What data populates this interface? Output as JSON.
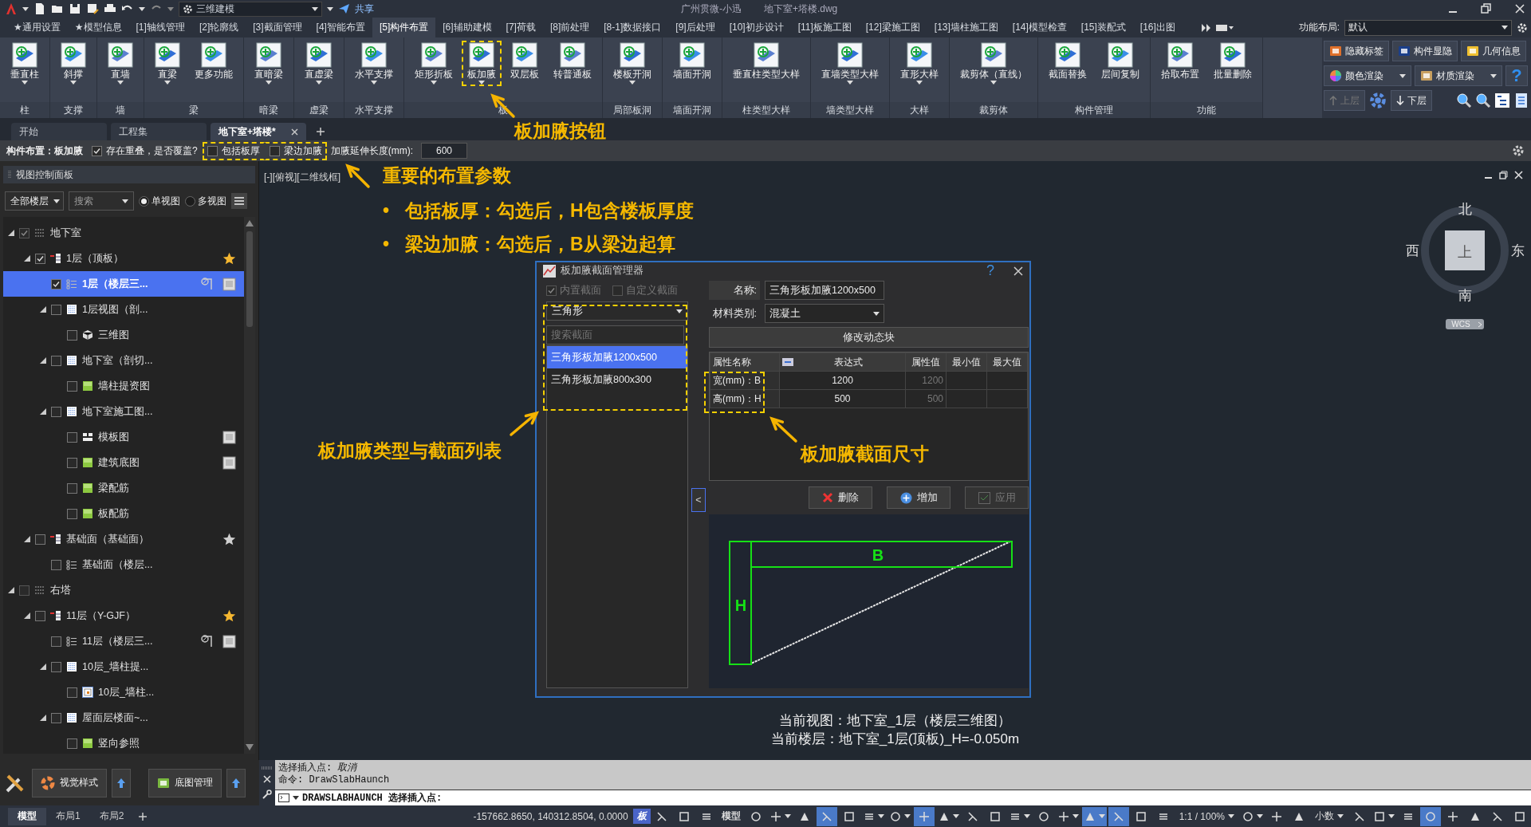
{
  "title_bar": {
    "workspace": "三维建模",
    "share": "共享",
    "app_name": "广州贯微-小迅",
    "file_name": "地下室+塔楼.dwg"
  },
  "ribbon_tabs": [
    {
      "label": "★通用设置",
      "selected": false
    },
    {
      "label": "★模型信息",
      "selected": false
    },
    {
      "label": "[1]轴线管理",
      "selected": false
    },
    {
      "label": "[2]轮廓线",
      "selected": false
    },
    {
      "label": "[3]截面管理",
      "selected": false
    },
    {
      "label": "[4]智能布置",
      "selected": false
    },
    {
      "label": "[5]构件布置",
      "selected": true
    },
    {
      "label": "[6]辅助建模",
      "selected": false
    },
    {
      "label": "[7]荷载",
      "selected": false
    },
    {
      "label": "[8]前处理",
      "selected": false
    },
    {
      "label": "[8-1]数据接口",
      "selected": false
    },
    {
      "label": "[9]后处理",
      "selected": false
    },
    {
      "label": "[10]初步设计",
      "selected": false
    },
    {
      "label": "[11]板施工图",
      "selected": false
    },
    {
      "label": "[12]梁施工图",
      "selected": false
    },
    {
      "label": "[13]墙柱施工图",
      "selected": false
    },
    {
      "label": "[14]模型检查",
      "selected": false
    },
    {
      "label": "[15]装配式",
      "selected": false
    },
    {
      "label": "[16]出图",
      "selected": false
    }
  ],
  "layout_selector": {
    "label": "功能布局:",
    "value": "默认"
  },
  "ribbon_groups": [
    {
      "title": "柱",
      "buttons": [
        {
          "label": "垂直柱",
          "dropdown": true,
          "highlighted": false
        }
      ]
    },
    {
      "title": "支撑",
      "buttons": [
        {
          "label": "斜撑",
          "dropdown": true,
          "highlighted": false
        }
      ]
    },
    {
      "title": "墙",
      "buttons": [
        {
          "label": "直墙",
          "dropdown": true,
          "highlighted": false
        }
      ]
    },
    {
      "title": "梁",
      "buttons": [
        {
          "label": "直梁",
          "dropdown": true,
          "highlighted": false
        },
        {
          "label": "更多功能",
          "dropdown": false,
          "highlighted": false
        }
      ]
    },
    {
      "title": "暗梁",
      "buttons": [
        {
          "label": "直暗梁",
          "dropdown": true,
          "highlighted": false
        }
      ]
    },
    {
      "title": "虚梁",
      "buttons": [
        {
          "label": "直虚梁",
          "dropdown": true,
          "highlighted": false
        }
      ]
    },
    {
      "title": "水平支撑",
      "buttons": [
        {
          "label": "水平支撑",
          "dropdown": true,
          "highlighted": false
        }
      ]
    },
    {
      "title": "板",
      "buttons": [
        {
          "label": "矩形折板",
          "dropdown": true,
          "highlighted": false
        },
        {
          "label": "板加腋",
          "dropdown": true,
          "highlighted": true
        },
        {
          "label": "双层板",
          "dropdown": false,
          "highlighted": false
        },
        {
          "label": "转普通板",
          "dropdown": false,
          "highlighted": false
        }
      ]
    },
    {
      "title": "局部板洞",
      "buttons": [
        {
          "label": "楼板开洞",
          "dropdown": true,
          "highlighted": false
        }
      ]
    },
    {
      "title": "墙面开洞",
      "buttons": [
        {
          "label": "墙面开洞",
          "dropdown": false,
          "highlighted": false
        }
      ]
    },
    {
      "title": "柱类型大样",
      "buttons": [
        {
          "label": "垂直柱类型大样",
          "dropdown": false,
          "highlighted": false
        }
      ]
    },
    {
      "title": "墙类型大样",
      "buttons": [
        {
          "label": "直墙类型大样",
          "dropdown": true,
          "highlighted": false
        }
      ]
    },
    {
      "title": "大样",
      "buttons": [
        {
          "label": "直形大样",
          "dropdown": true,
          "highlighted": false
        }
      ]
    },
    {
      "title": "裁剪体",
      "buttons": [
        {
          "label": "裁剪体（直线）",
          "dropdown": true,
          "highlighted": false
        }
      ]
    },
    {
      "title": "构件管理",
      "buttons": [
        {
          "label": "截面替换",
          "dropdown": false,
          "highlighted": false
        },
        {
          "label": "层间复制",
          "dropdown": false,
          "highlighted": false
        }
      ]
    },
    {
      "title": "功能",
      "buttons": [
        {
          "label": "拾取布置",
          "dropdown": false,
          "highlighted": false
        },
        {
          "label": "批量删除",
          "dropdown": false,
          "highlighted": false
        }
      ]
    }
  ],
  "ribbon_side": {
    "toggles": [
      "隐藏标签",
      "构件显隐",
      "几何信息"
    ],
    "renders": [
      "颜色渲染",
      "材质渲染"
    ],
    "help": "?",
    "floor_up": {
      "label": "上层",
      "disabled": true
    },
    "floor_down": {
      "label": "下层",
      "disabled": false
    }
  },
  "doc_tabs": [
    {
      "label": "开始",
      "selected": false,
      "closable": false
    },
    {
      "label": "工程集",
      "selected": false,
      "closable": false
    },
    {
      "label": "地下室+塔楼*",
      "selected": true,
      "closable": true
    }
  ],
  "options_bar": {
    "label": "构件布置：板加腋",
    "options": [
      {
        "label": "存在重叠，是否覆盖?",
        "checked": true,
        "highlighted": false
      },
      {
        "label": "包括板厚",
        "checked": false,
        "highlighted": true
      },
      {
        "label": "梁边加腋",
        "checked": false,
        "highlighted": true
      }
    ],
    "extend_label": "加腋延伸长度(mm):",
    "extend_value": "600"
  },
  "view_panel": {
    "title": "视图控制面板",
    "floor_filter": "全部楼层",
    "search_placeholder": "搜索",
    "view_modes": [
      {
        "label": "单视图",
        "selected": true
      },
      {
        "label": "多视图",
        "selected": false
      }
    ],
    "tree": [
      {
        "label": "地下室",
        "kind": "group",
        "checked": true,
        "selected": false,
        "expanded": true,
        "children": [
          {
            "label": "1层（顶板）",
            "kind": "floor",
            "checked": true,
            "selected": false,
            "expanded": true,
            "star": true,
            "children": [
              {
                "label": "1层（楼层三...",
                "kind": "list",
                "checked": true,
                "selected": true,
                "tools": [
                  {
                    "kind": "section"
                  },
                  {
                    "kind": "sheet"
                  }
                ]
              },
              {
                "label": "1层视图（剖...",
                "kind": "view",
                "checked": false,
                "selected": false,
                "expanded": true,
                "children": [
                  {
                    "label": "三维图",
                    "kind": "cube",
                    "checked": false,
                    "selected": false
                  }
                ]
              },
              {
                "label": "地下室（剖切...",
                "kind": "view",
                "checked": false,
                "selected": false,
                "expanded": true,
                "children": [
                  {
                    "label": "墙柱提资图",
                    "kind": "green",
                    "checked": false,
                    "selected": false
                  }
                ]
              },
              {
                "label": "地下室施工图...",
                "kind": "view",
                "checked": false,
                "selected": false,
                "expanded": true,
                "children": [
                  {
                    "label": "模板图",
                    "kind": "plan",
                    "checked": false,
                    "selected": false,
                    "tools": [
                      {
                        "kind": "sheet"
                      }
                    ]
                  },
                  {
                    "label": "建筑底图",
                    "kind": "green",
                    "checked": false,
                    "selected": false,
                    "tools": [
                      {
                        "kind": "sheet"
                      }
                    ]
                  },
                  {
                    "label": "梁配筋",
                    "kind": "green",
                    "checked": false,
                    "selected": false
                  },
                  {
                    "label": "板配筋",
                    "kind": "green",
                    "checked": false,
                    "selected": false
                  }
                ]
              }
            ]
          },
          {
            "label": "基础面（基础面）",
            "kind": "floor",
            "checked": false,
            "selected": false,
            "expanded": true,
            "star": false,
            "children": [
              {
                "label": "基础面（楼层...",
                "kind": "list",
                "checked": false,
                "selected": false
              }
            ]
          }
        ]
      },
      {
        "label": "右塔",
        "kind": "group",
        "checked": false,
        "selected": false,
        "expanded": true,
        "children": [
          {
            "label": "11层（Y-GJF）",
            "kind": "floor",
            "checked": false,
            "selected": false,
            "expanded": true,
            "star": true,
            "children": [
              {
                "label": "11层（楼层三...",
                "kind": "list",
                "checked": false,
                "selected": false,
                "tools": [
                  {
                    "kind": "section"
                  },
                  {
                    "kind": "sheet"
                  }
                ]
              },
              {
                "label": "10层_墙柱提...",
                "kind": "view",
                "checked": false,
                "selected": false,
                "expanded": true,
                "children": [
                  {
                    "label": "10层_墙柱...",
                    "kind": "frame",
                    "checked": false,
                    "selected": false
                  }
                ]
              },
              {
                "label": "屋面层楼面~...",
                "kind": "view",
                "checked": false,
                "selected": false,
                "expanded": true,
                "children": [
                  {
                    "label": "竖向参照",
                    "kind": "green",
                    "checked": false,
                    "selected": false
                  }
                ]
              }
            ]
          }
        ]
      }
    ],
    "bottom_buttons": [
      "视觉样式",
      "底图管理"
    ]
  },
  "viewport": {
    "label": "[-][俯视][二维线框]",
    "compass": {
      "north": "北",
      "south": "南",
      "east": "东",
      "west": "西",
      "top": "上",
      "wcs": "WCS"
    },
    "current_view": "当前视图：地下室_1层（楼层三维图）",
    "current_floor": "当前楼层：地下室_1层(顶板)_H=-0.050m"
  },
  "dialog": {
    "title": "板加腋截面管理器",
    "help": "?",
    "filters": [
      {
        "label": "内置截面",
        "checked": true,
        "disabled": true
      },
      {
        "label": "自定义截面",
        "checked": false,
        "disabled": true
      }
    ],
    "shape": "三角形",
    "search_placeholder": "搜索截面",
    "sections": [
      {
        "label": "三角形板加腋1200x500",
        "selected": true
      },
      {
        "label": "三角形板加腋800x300",
        "selected": false
      }
    ],
    "name_label": "名称:",
    "name_value": "三角形板加腋1200x500",
    "material_label": "材料类别:",
    "material_value": "混凝土",
    "modify_button": "修改动态块",
    "columns": [
      "属性名称",
      "表达式",
      "属性值",
      "最小值",
      "最大值"
    ],
    "rows": [
      {
        "name": "宽(mm)：B",
        "expression": "1200",
        "value": "1200"
      },
      {
        "name": "高(mm)：H",
        "expression": "500",
        "value": "500"
      }
    ],
    "collapse": "<",
    "buttons": [
      {
        "kind": "delete",
        "label": "删除",
        "disabled": false
      },
      {
        "kind": "add",
        "label": "增加",
        "disabled": false
      },
      {
        "kind": "apply",
        "label": "应用",
        "disabled": true
      }
    ],
    "preview_labels": {
      "width": "B",
      "height": "H"
    }
  },
  "command": {
    "history": [
      "选择插入点: *取消*",
      "命令: DrawSlabHaunch"
    ],
    "prompt": "DRAWSLABHAUNCH 选择插入点:"
  },
  "layout_tabs": [
    {
      "label": "模型",
      "selected": true
    },
    {
      "label": "布局1",
      "selected": false
    },
    {
      "label": "布局2",
      "selected": false
    }
  ],
  "status_bar": {
    "coordinates": "-157662.8650, 140312.8504, 0.0000",
    "items": [
      {
        "kind": "badge",
        "label": "板"
      },
      {
        "kind": "toggle",
        "on": false,
        "dropdown": false
      },
      {
        "kind": "toggle",
        "on": false,
        "dropdown": false
      },
      {
        "kind": "toggle",
        "on": false,
        "dropdown": false
      },
      {
        "kind": "text",
        "label": "模型"
      },
      {
        "kind": "toggle",
        "on": false,
        "dropdown": false
      },
      {
        "kind": "toggle",
        "on": false,
        "dropdown": true
      },
      {
        "kind": "toggle",
        "on": false,
        "dropdown": false
      },
      {
        "kind": "toggle",
        "on": true,
        "dropdown": false
      },
      {
        "kind": "toggle",
        "on": false,
        "dropdown": false
      },
      {
        "kind": "toggle",
        "on": false,
        "dropdown": true
      },
      {
        "kind": "toggle",
        "on": false,
        "dropdown": true
      },
      {
        "kind": "toggle",
        "on": true,
        "dropdown": false
      },
      {
        "kind": "toggle",
        "on": false,
        "dropdown": true
      },
      {
        "kind": "toggle",
        "on": false,
        "dropdown": false
      },
      {
        "kind": "toggle",
        "on": false,
        "dropdown": false
      },
      {
        "kind": "toggle",
        "on": false,
        "dropdown": true
      },
      {
        "kind": "toggle",
        "on": false,
        "dropdown": false
      },
      {
        "kind": "toggle",
        "on": false,
        "dropdown": true
      },
      {
        "kind": "toggle",
        "on": true,
        "dropdown": true
      },
      {
        "kind": "toggle",
        "on": true,
        "dropdown": false
      },
      {
        "kind": "toggle",
        "on": false,
        "dropdown": false
      },
      {
        "kind": "toggle",
        "on": false,
        "dropdown": false
      },
      {
        "kind": "dropdown",
        "label": "1:1 / 100%"
      },
      {
        "kind": "toggle",
        "on": false,
        "dropdown": true
      },
      {
        "kind": "toggle",
        "on": false,
        "dropdown": false
      },
      {
        "kind": "toggle",
        "on": false,
        "dropdown": false
      },
      {
        "kind": "dropdown",
        "label": "小数"
      },
      {
        "kind": "toggle",
        "on": false,
        "dropdown": false
      },
      {
        "kind": "toggle",
        "on": false,
        "dropdown": true
      },
      {
        "kind": "toggle",
        "on": false,
        "dropdown": false
      },
      {
        "kind": "toggle",
        "on": true,
        "dropdown": false
      },
      {
        "kind": "toggle",
        "on": false,
        "dropdown": false
      },
      {
        "kind": "toggle",
        "on": false,
        "dropdown": false
      },
      {
        "kind": "toggle",
        "on": false,
        "dropdown": false
      },
      {
        "kind": "toggle",
        "on": false,
        "dropdown": false
      }
    ]
  },
  "annotations": {
    "button_note": "板加腋按钮",
    "params_title": "重要的布置参数",
    "bullets": [
      {
        "bullet": "•",
        "text": "包括板厚：勾选后，H包含楼板厚度"
      },
      {
        "bullet": "•",
        "text": "梁边加腋：勾选后，B从梁边起算"
      }
    ],
    "list_note": "板加腋类型与截面列表",
    "size_note": "板加腋截面尺寸"
  }
}
